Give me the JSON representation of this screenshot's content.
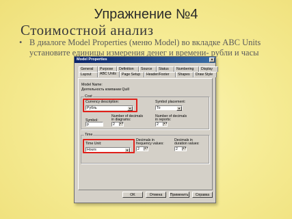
{
  "slide": {
    "title": "Упражнение №4",
    "subtitle": "Стоимостной анализ",
    "bullet_char": "•",
    "bullet_line1": "В диалоге Model Properties (меню Model) во вкладке ABC Units",
    "bullet_line2": "установите единицы измерения денег и времени- рубли и часы"
  },
  "dialog": {
    "title": "Model Properties",
    "close_glyph": "×",
    "tabs_row1": [
      "General",
      "Purpose",
      "Definition",
      "Source",
      "Status",
      "Numbering",
      "Display"
    ],
    "tabs_row2": [
      "Layout",
      "ABC Units",
      "Page Setup",
      "Header/Footer",
      "Shapes",
      "Draw Style"
    ],
    "model_name_label": "Model Name:",
    "model_name_value": "Деятельность компании Quill",
    "cost_group_label": "Cost",
    "currency_label": "Currency description:",
    "currency_value": "Рубль",
    "symbol_placement_label": "Symbol placement:",
    "symbol_placement_value": "To",
    "symbol_label": "Symbol:",
    "symbol_value": "p",
    "decimals_diagram_label_1": "Number of decimals",
    "decimals_diagram_label_2": "in diagrams:",
    "decimals_diagram_value": "2",
    "decimals_reports_label_1": "Number of decimals",
    "decimals_reports_label_2": "in reports:",
    "decimals_reports_value": "2",
    "time_group_label": "Time",
    "time_unit_label": "Time Unit:",
    "time_unit_value": "Hours",
    "freq_label_1": "Decimals in",
    "freq_label_2": "frequency values:",
    "freq_value": "2",
    "dur_label_1": "Decimals in",
    "dur_label_2": "duration values:",
    "dur_value": "2",
    "ok_label": "OK",
    "cancel_label": "Отмена",
    "apply_label": "Применить",
    "help_label": "Справка",
    "dropdown_glyph": "▼",
    "spin_glyph": "▲▼"
  }
}
